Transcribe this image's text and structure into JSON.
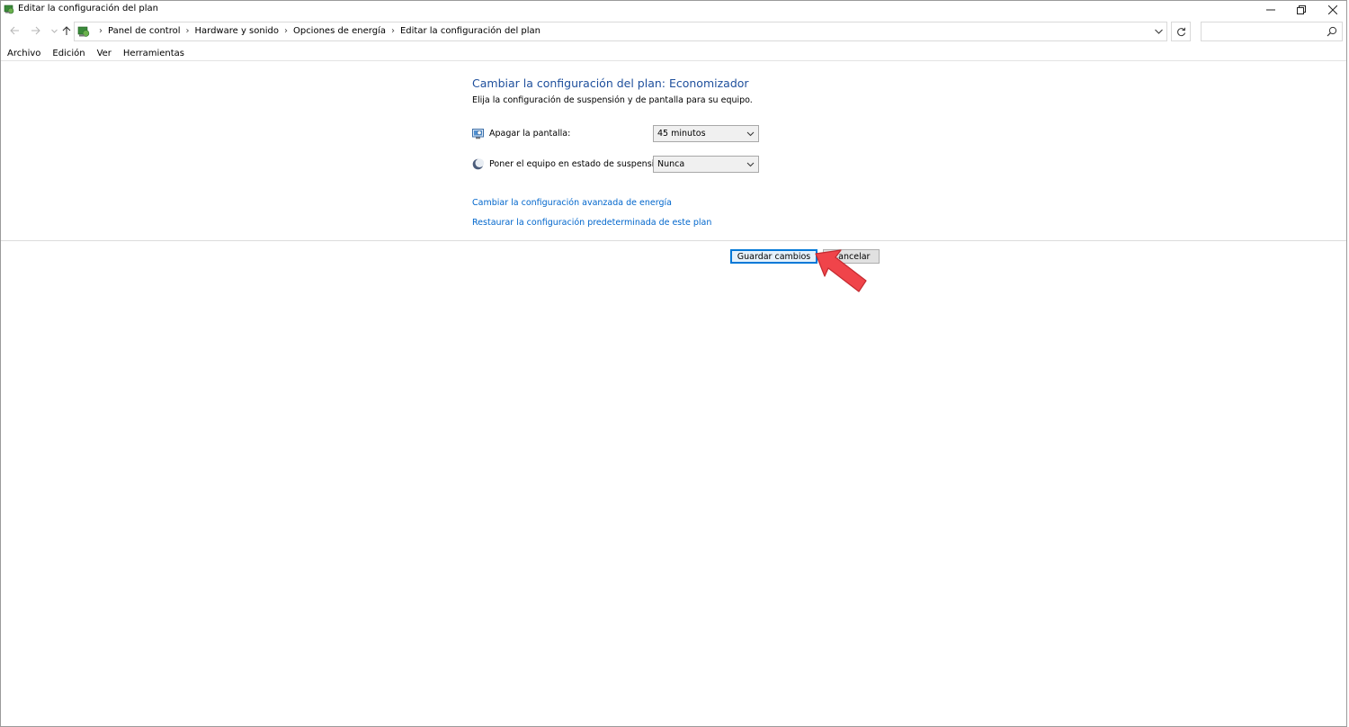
{
  "window": {
    "title": "Editar la configuración del plan"
  },
  "breadcrumb": [
    "Panel de control",
    "Hardware y sonido",
    "Opciones de energía",
    "Editar la configuración del plan"
  ],
  "search": {
    "placeholder": ""
  },
  "menu": [
    "Archivo",
    "Edición",
    "Ver",
    "Herramientas"
  ],
  "content": {
    "heading": "Cambiar la configuración del plan: Economizador",
    "subheading": "Elija la configuración de suspensión y de pantalla para su equipo.",
    "settings": [
      {
        "label": "Apagar la pantalla:",
        "value": "45 minutos",
        "icon": "monitor-icon"
      },
      {
        "label": "Poner el equipo en estado de suspensión:",
        "value": "Nunca",
        "icon": "moon-icon"
      }
    ],
    "links": [
      "Cambiar la configuración avanzada de energía",
      "Restaurar la configuración predeterminada de este plan"
    ],
    "buttons": {
      "save": "Guardar cambios",
      "cancel": "Cancelar"
    }
  },
  "colors": {
    "heading": "#1e4f9c",
    "link": "#0066cc",
    "save_border": "#0078d7",
    "pointer": "#f0444a"
  }
}
